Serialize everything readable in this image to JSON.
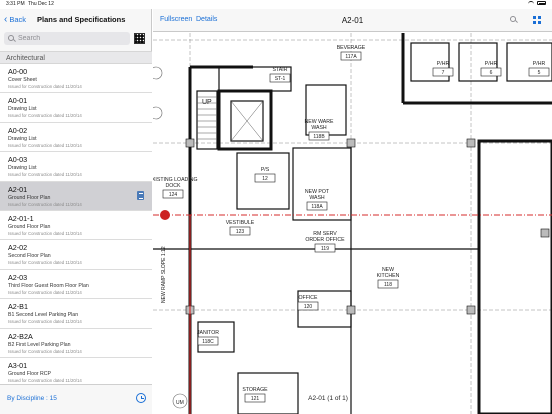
{
  "status_bar": {
    "time": "3:31 PM",
    "date": "Thu Dec 12"
  },
  "sidebar": {
    "back_label": "Back",
    "title": "Plans and Specifications",
    "search_placeholder": "Search",
    "section": "Architectural",
    "items": [
      {
        "code": "A0-00",
        "desc": "Cover Sheet",
        "issued": "Issued for Construction dated 11/20/14"
      },
      {
        "code": "A0-01",
        "desc": "Drawing List",
        "issued": "Issued for Construction dated 11/20/14"
      },
      {
        "code": "A0-02",
        "desc": "Drawing List",
        "issued": "Issued for Construction dated 11/20/14"
      },
      {
        "code": "A0-03",
        "desc": "Drawing List",
        "issued": "Issued for Construction dated 11/20/14"
      },
      {
        "code": "A2-01",
        "desc": "Ground Floor Plan",
        "issued": "Issued for Construction dated 11/20/14",
        "selected": true
      },
      {
        "code": "A2-01-1",
        "desc": "Ground Floor Plan",
        "issued": "Issued for Construction dated 11/20/14"
      },
      {
        "code": "A2-02",
        "desc": "Second Floor Plan",
        "issued": "Issued for Construction dated 11/20/14"
      },
      {
        "code": "A2-03",
        "desc": "Third Floor Guest Room Floor Plan",
        "issued": "Issued for Construction dated 11/20/14"
      },
      {
        "code": "A2-B1",
        "desc": "B1 Second Level Parking Plan",
        "issued": "Issued for Construction dated 11/20/14"
      },
      {
        "code": "A2-B2A",
        "desc": "B2 First Level Parking Plan",
        "issued": "Issued for Construction dated 11/20/14"
      },
      {
        "code": "A3-01",
        "desc": "Ground Floor RCP",
        "issued": "Issued for Construction dated 11/20/14"
      }
    ],
    "footer_label": "By Discipline : 15"
  },
  "toolbar": {
    "fullscreen_label": "Fullscreen",
    "details_label": "Details",
    "sheet_title": "A2-01"
  },
  "drawing": {
    "rooms": [
      {
        "name": "BEVERAGE",
        "num": "117A"
      },
      {
        "name": "STAIR",
        "num": "ST-1"
      },
      {
        "name": "P/HR",
        "num": "7"
      },
      {
        "name": "P/HR",
        "num": "6"
      },
      {
        "name": "P/HR",
        "num": "5"
      },
      {
        "name": "NEW WARE WASH",
        "num": "118B"
      },
      {
        "name": "P/S",
        "num": "12"
      },
      {
        "name": "EXISTING LOADING DOCK",
        "num": "124"
      },
      {
        "name": "NEW POT WASH",
        "num": "118A"
      },
      {
        "name": "VESTIBULE",
        "num": "123"
      },
      {
        "name": "RM SERV ORDER OFFICE",
        "num": "119"
      },
      {
        "name": "NEW KITCHEN",
        "num": "118"
      },
      {
        "name": "OFFICE",
        "num": "120"
      },
      {
        "name": "JANITOR",
        "num": "118C"
      },
      {
        "name": "STORAGE",
        "num": "121"
      }
    ],
    "ramp_label": "NEW RAMP SLOPE 1:12",
    "up_label": "UP",
    "um_label": "UM",
    "page_indicator": "A2-01 (1 of 1)",
    "colors": {
      "cut_line": "#d42b2b",
      "walls": "#111111"
    }
  }
}
